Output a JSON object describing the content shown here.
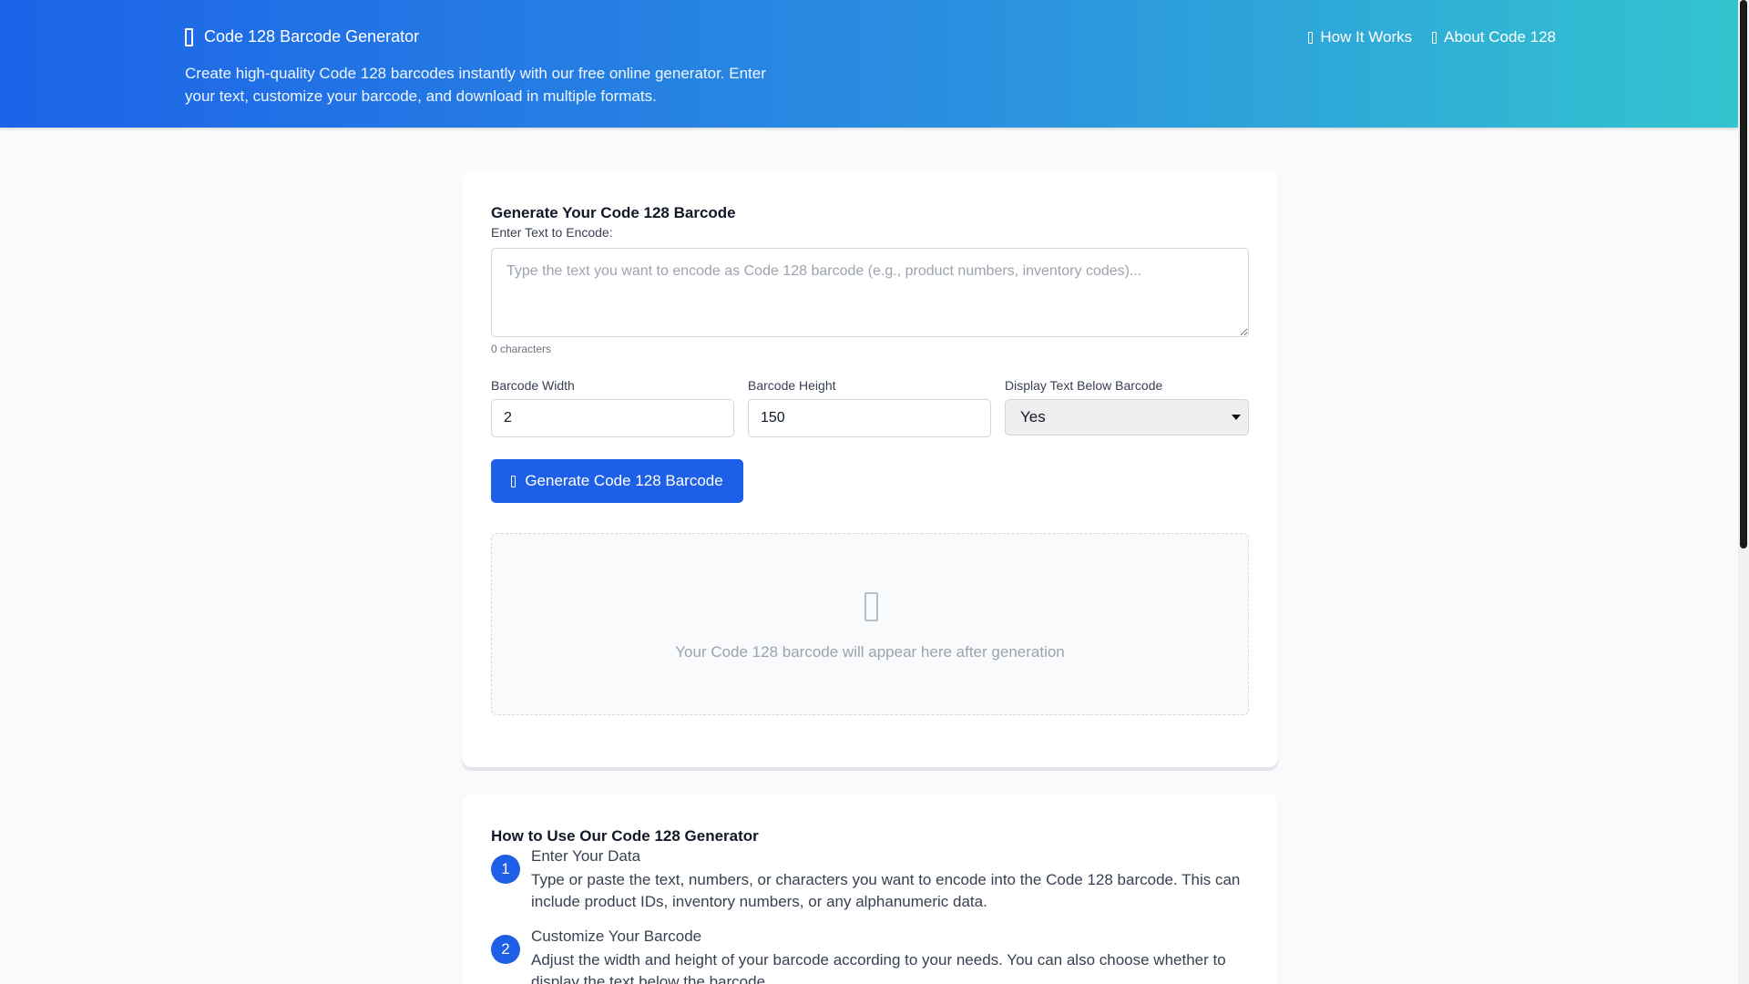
{
  "header": {
    "brand": "Code 128 Barcode Generator",
    "tagline": "Create high-quality Code 128 barcodes instantly with our free online generator. Enter your text, customize your barcode, and download in multiple formats.",
    "nav": [
      {
        "label": "How It Works",
        "icon": "info-icon"
      },
      {
        "label": "About Code 128",
        "icon": "book-icon"
      }
    ]
  },
  "generator": {
    "title": "Generate Your Code 128 Barcode",
    "text_label": "Enter Text to Encode:",
    "text_placeholder": "Type the text you want to encode as Code 128 barcode (e.g., product numbers, inventory codes)...",
    "text_value": "",
    "char_count": "0 characters",
    "width_label": "Barcode Width",
    "width_value": "2",
    "height_label": "Barcode Height",
    "height_value": "150",
    "display_label": "Display Text Below Barcode",
    "display_value": "Yes",
    "button_label": "Generate Code 128 Barcode",
    "preview_text": "Your Code 128 barcode will appear here after generation"
  },
  "how": {
    "title": "How to Use Our Code 128 Generator",
    "steps": [
      {
        "num": "1",
        "title": "Enter Your Data",
        "desc": "Type or paste the text, numbers, or characters you want to encode into the Code 128 barcode. This can include product IDs, inventory numbers, or any alphanumeric data."
      },
      {
        "num": "2",
        "title": "Customize Your Barcode",
        "desc": "Adjust the width and height of your barcode according to your needs. You can also choose whether to display the text below the barcode."
      }
    ]
  },
  "colors": {
    "accent": "#1d5fe6",
    "header_start": "#1d63e8",
    "header_end": "#33c4cf"
  }
}
